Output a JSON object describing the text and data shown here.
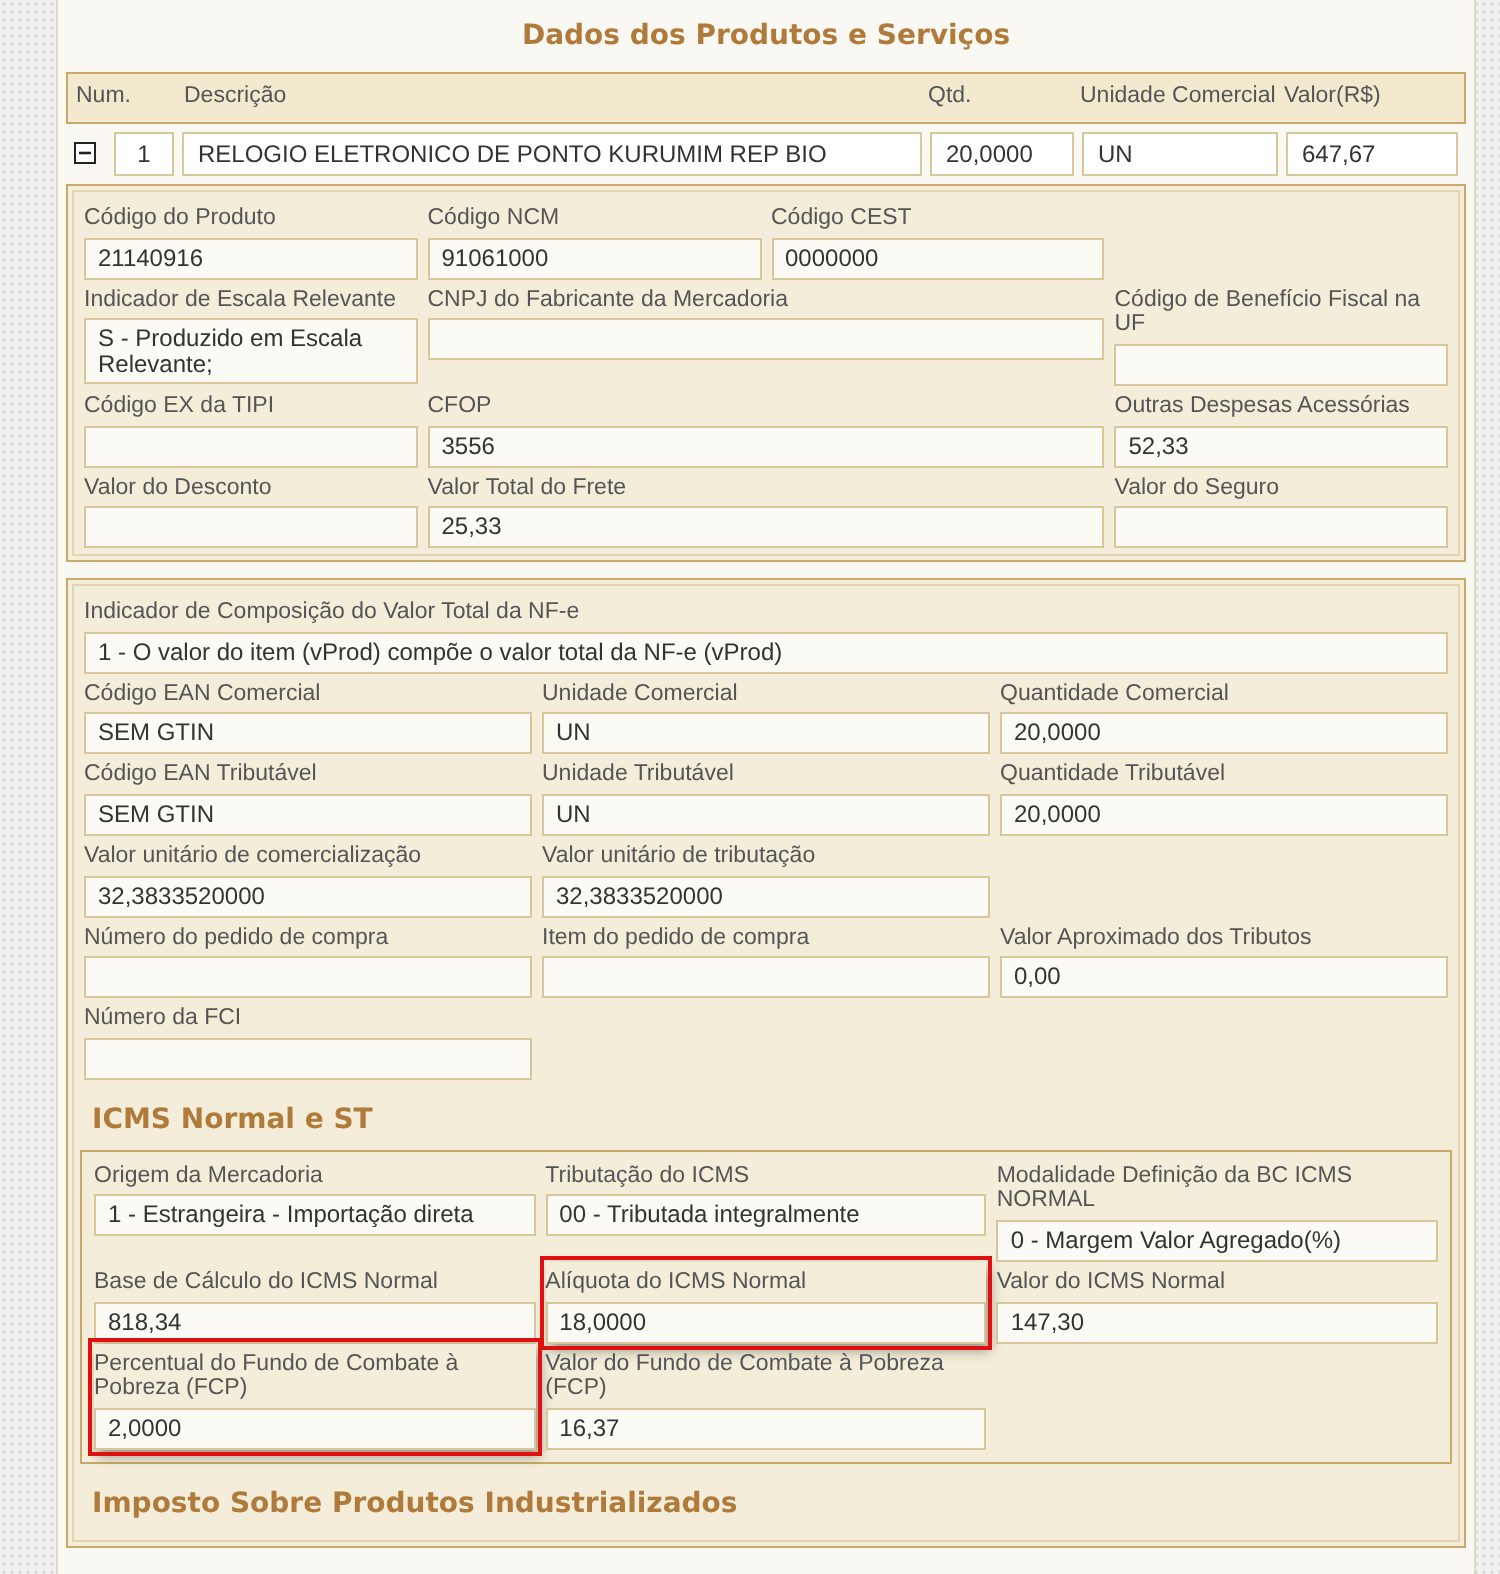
{
  "title": "Dados dos Produtos e Serviços",
  "columns": [
    "Num.",
    "Descrição",
    "Qtd.",
    "Unidade Comercial",
    "Valor(R$)"
  ],
  "item": {
    "expanded": true,
    "cells": [
      "1",
      "RELOGIO ELETRONICO DE PONTO KURUMIM REP BIO",
      "20,0000",
      "UN",
      "647,67"
    ]
  },
  "product_panel": {
    "rows": [
      [
        {
          "label": "Código do Produto",
          "value": "21140916"
        },
        {
          "label": "Código NCM",
          "value": "91061000"
        },
        {
          "label": "Código CEST",
          "value": "0000000"
        }
      ],
      [
        {
          "label": "Indicador de Escala Relevante",
          "value": "S - Produzido em Escala Relevante;"
        },
        {
          "label": "CNPJ do Fabricante da Mercadoria"
        },
        {
          "label": "Código de Benefício Fiscal na UF"
        }
      ],
      [
        {
          "label": "Código EX da TIPI"
        },
        {
          "label": "CFOP",
          "value": "3556"
        },
        {
          "label": "Outras Despesas Acessórias",
          "value": "52,33"
        }
      ],
      [
        {
          "label": "Valor do Desconto"
        },
        {
          "label": "Valor Total do Frete",
          "value": "25,33"
        },
        {
          "label": "Valor do Seguro"
        }
      ]
    ]
  },
  "value_panel": {
    "rows": [
      [
        {
          "label": "Indicador de Composição do Valor Total da NF-e",
          "value": "1 - O valor do item (vProd) compõe o valor total da NF-e (vProd)"
        }
      ],
      [
        {
          "label": "Código EAN Comercial",
          "value": "SEM GTIN"
        },
        {
          "label": "Unidade Comercial",
          "value": "UN"
        },
        {
          "label": "Quantidade Comercial",
          "value": "20,0000"
        }
      ],
      [
        {
          "label": "Código EAN Tributável",
          "value": "SEM GTIN"
        },
        {
          "label": "Unidade Tributável",
          "value": "UN"
        },
        {
          "label": "Quantidade Tributável",
          "value": "20,0000"
        }
      ],
      [
        {
          "label": "Valor unitário de comercialização",
          "value": "32,3833520000"
        },
        {
          "label": "Valor unitário de tributação",
          "value": "32,3833520000"
        }
      ],
      [
        {
          "label": "Número do pedido de compra"
        },
        {
          "label": "Item do pedido de compra"
        },
        {
          "label": "Valor Aproximado dos Tributos",
          "value": "0,00"
        }
      ],
      [
        {
          "label": "Número da FCI"
        }
      ]
    ]
  },
  "icms": {
    "title": "ICMS Normal e ST",
    "rows": [
      [
        {
          "label": "Origem da Mercadoria",
          "value": "1 - Estrangeira - Importação direta",
          "highlighted": false
        },
        {
          "label": "Tributação do ICMS",
          "value": "00 - Tributada integralmente",
          "highlighted": false
        },
        {
          "label": "Modalidade Definição da BC ICMS NORMAL",
          "value": "0 - Margem Valor Agregado(%)",
          "highlighted": false
        }
      ],
      [
        {
          "label": "Base de Cálculo do ICMS Normal",
          "value": "818,34",
          "highlighted": false
        },
        {
          "label": "Alíquota do ICMS Normal",
          "value": "18,0000",
          "highlighted": true
        },
        {
          "label": "Valor do ICMS Normal",
          "value": "147,30",
          "highlighted": false
        }
      ],
      [
        {
          "label": "Percentual do Fundo de Combate à Pobreza (FCP)",
          "value": "2,0000",
          "highlighted": true
        },
        {
          "label": "Valor do Fundo de Combate à Pobreza (FCP)",
          "value": "16,37",
          "highlighted": false
        }
      ]
    ]
  },
  "next_section": {
    "title": "Imposto Sobre Produtos Industrializados"
  }
}
